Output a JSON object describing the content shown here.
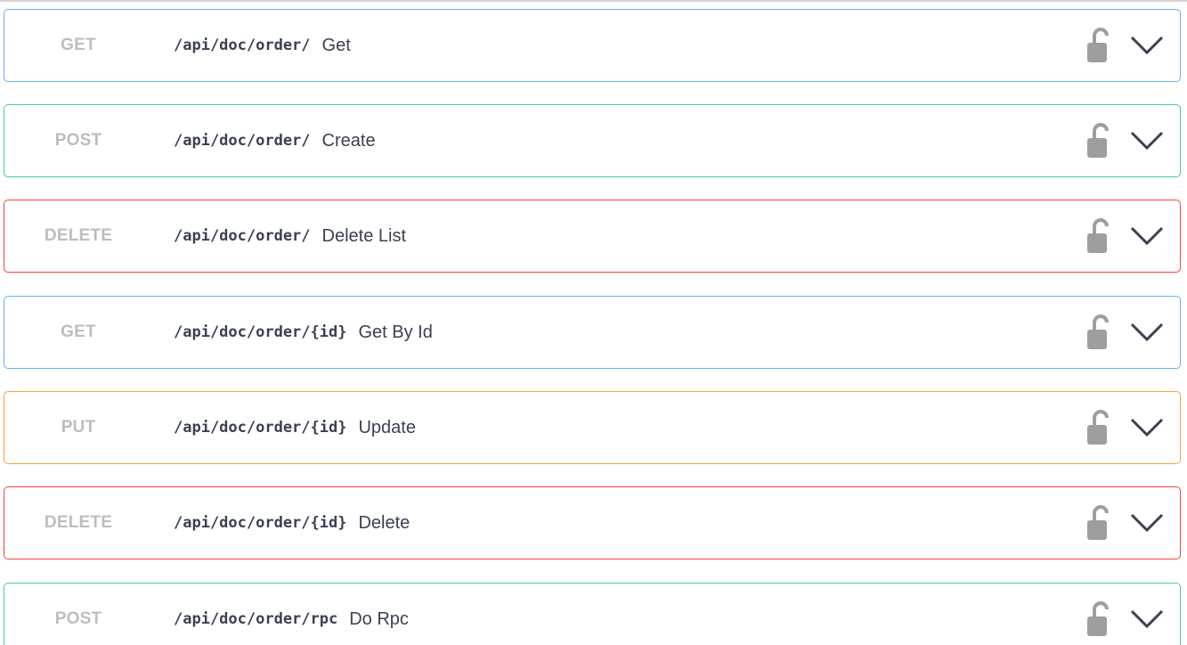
{
  "operations": [
    {
      "method": "GET",
      "path": "/api/doc/order/",
      "summary": "Get",
      "color": "#61affe"
    },
    {
      "method": "POST",
      "path": "/api/doc/order/",
      "summary": "Create",
      "color": "#49cc90"
    },
    {
      "method": "DELETE",
      "path": "/api/doc/order/",
      "summary": "Delete List",
      "color": "#f93e3e"
    },
    {
      "method": "GET",
      "path": "/api/doc/order/{id}",
      "summary": "Get By Id",
      "color": "#61affe"
    },
    {
      "method": "PUT",
      "path": "/api/doc/order/{id}",
      "summary": "Update",
      "color": "#fca130"
    },
    {
      "method": "DELETE",
      "path": "/api/doc/order/{id}",
      "summary": "Delete",
      "color": "#f93e3e"
    },
    {
      "method": "POST",
      "path": "/api/doc/order/rpc",
      "summary": "Do Rpc",
      "color": "#49cc90"
    }
  ],
  "icons": {
    "lock": "unlocked-padlock-icon",
    "expand": "chevron-down-icon"
  },
  "colors": {
    "method_text": "#bdbdbd",
    "path_text": "#3b4151",
    "lock": "#9e9e9e",
    "chevron": "#3b4151"
  }
}
